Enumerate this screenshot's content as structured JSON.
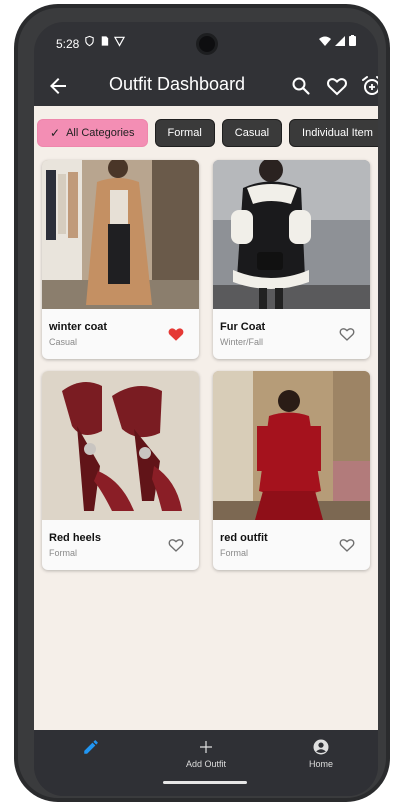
{
  "status_bar": {
    "time": "5:28"
  },
  "app_bar": {
    "title": "Outfit Dashboard"
  },
  "filters": {
    "chips": [
      "All Categories",
      "Formal",
      "Casual",
      "Individual Item"
    ],
    "selected": "All Categories"
  },
  "outfits": [
    {
      "name": "winter coat",
      "category": "Casual",
      "favorite": true,
      "image": "beige coat outfit photo"
    },
    {
      "name": "Fur Coat",
      "category": "Winter/Fall",
      "favorite": false,
      "image": "black fur coat photo"
    },
    {
      "name": "Red heels",
      "category": "Formal",
      "favorite": false,
      "image": "red embellished heels photo"
    },
    {
      "name": "red outfit",
      "category": "Formal",
      "favorite": false,
      "image": "red suit outfit photo"
    }
  ],
  "bottom_nav": {
    "items": [
      {
        "icon": "edit-icon",
        "label": ""
      },
      {
        "icon": "add-icon",
        "label": "Add Outfit"
      },
      {
        "icon": "account-icon",
        "label": "Home"
      }
    ]
  },
  "colors": {
    "background": "#f5efe9",
    "chip_selected": "#f38eb4",
    "chip_default": "#3a3a3a",
    "favorite_active": "#e53935",
    "nav_active": "#2196f3"
  }
}
